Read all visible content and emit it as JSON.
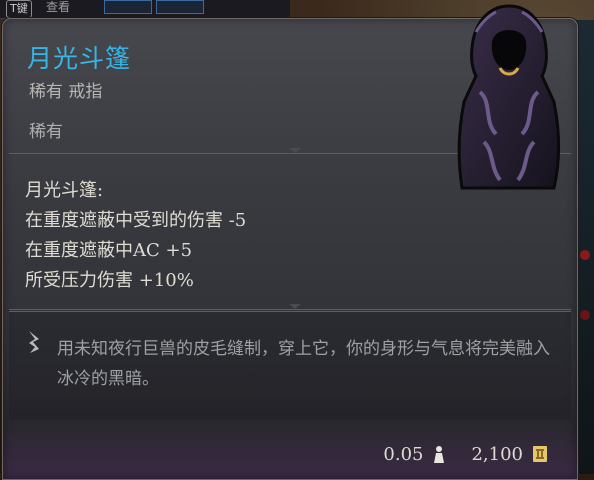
{
  "header": {
    "key_label": "T键",
    "view_label": "查看"
  },
  "item": {
    "name": "月光斗篷",
    "subtitle": "稀有 戒指",
    "rarity": "稀有",
    "portrait_icon": "hooded-cloak-icon"
  },
  "effects": {
    "heading": "月光斗篷:",
    "lines": [
      "在重度遮蔽中受到的伤害 -5",
      "在重度遮蔽中AC +5",
      "所受压力伤害 +10%"
    ]
  },
  "flavor": {
    "icon": "quill-icon",
    "text": "用未知夜行巨兽的皮毛缝制，穿上它，你的身形与气息将完美融入冰冷的黑暗。"
  },
  "footer": {
    "weight": "0.05",
    "weight_icon": "weight-icon",
    "value": "2,100",
    "value_icon": "gold-coin-icon"
  },
  "colors": {
    "title": "#37b6e6",
    "text": "#dfdcd4",
    "muted": "#aeb0b0",
    "flavor": "#9ea0a3"
  }
}
